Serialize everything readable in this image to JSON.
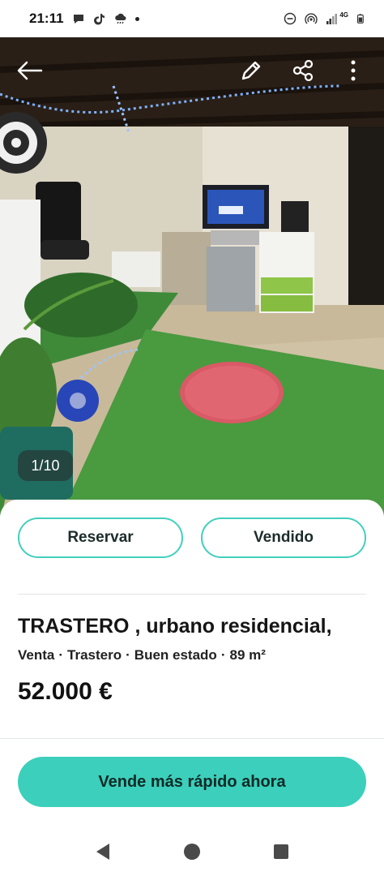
{
  "status_bar": {
    "time": "21:11",
    "icons": [
      "chat-bubble-icon",
      "tiktok-icon",
      "cloud-rain-icon",
      "notification-dot-icon",
      "do-not-disturb-icon",
      "hotspot-icon",
      "signal-icon",
      "battery-icon"
    ],
    "network": "4G"
  },
  "toolbar": {
    "back_icon": "arrow-left-icon",
    "edit_icon": "pencil-icon",
    "share_icon": "share-icon",
    "menu_icon": "more-vertical-icon"
  },
  "photo": {
    "counter": "1/10"
  },
  "actions": {
    "reserve_label": "Reservar",
    "sold_label": "Vendido"
  },
  "listing": {
    "title": "TRASTERO , urbano residencial,",
    "meta": [
      "Venta",
      "Trastero",
      "Buen estado",
      "89 m²"
    ],
    "price": "52.000 €"
  },
  "cta": {
    "label": "Vende más rápido ahora"
  },
  "colors": {
    "accent": "#3ccfbb",
    "accent_border": "#43cfbc"
  }
}
